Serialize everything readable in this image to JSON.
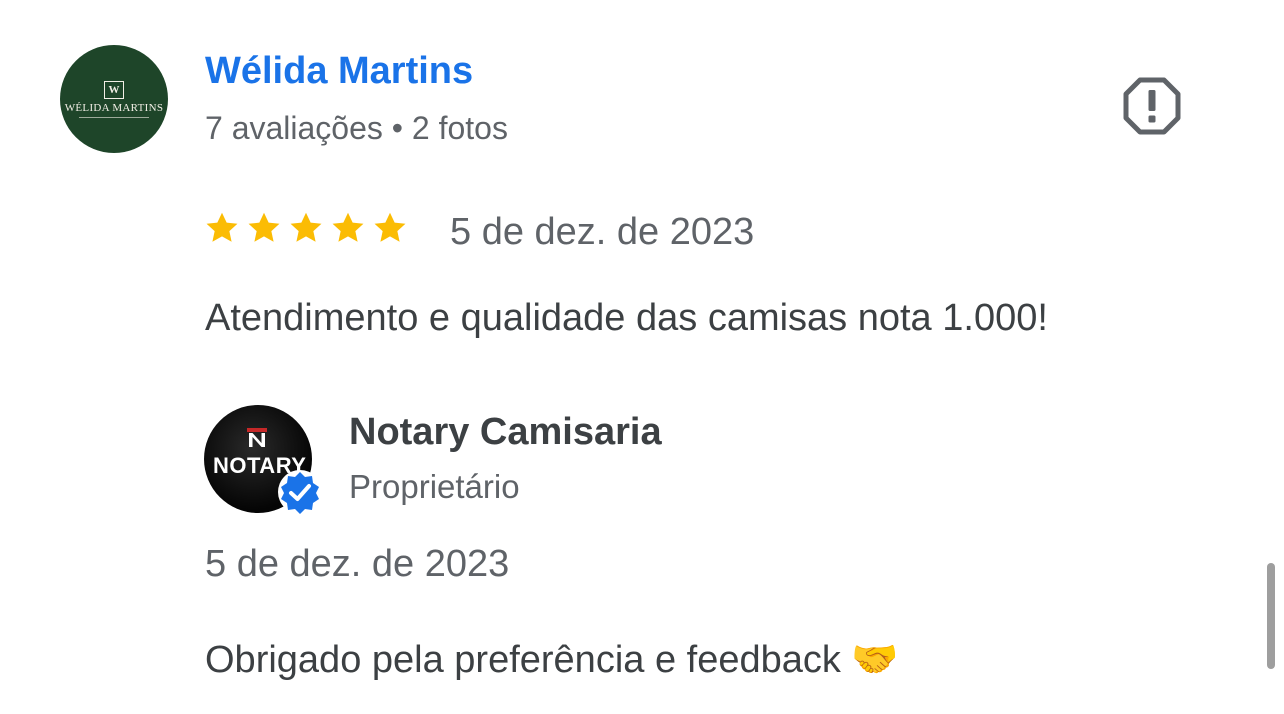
{
  "review": {
    "reviewer": {
      "name": "Wélida Martins",
      "meta": "7 avaliações • 2 fotos",
      "avatar": {
        "monogram": "W",
        "brand_text": "WÉLIDA MARTINS",
        "bg_color": "#1e4529"
      }
    },
    "rating": {
      "stars": 5,
      "max": 5,
      "color": "#fbbc04"
    },
    "date": "5 de dez. de 2023",
    "text": "Atendimento e qualidade das camisas nota 1.000!",
    "report_icon": "report-flag-icon"
  },
  "reply": {
    "owner": {
      "name": "Notary Camisaria",
      "role": "Proprietário",
      "avatar": {
        "logo_text": "NOTARY",
        "badge_icon": "verified-badge-icon",
        "badge_color": "#1a73e8"
      }
    },
    "date": "5 de dez. de 2023",
    "text": "Obrigado pela preferência e feedback 🤝"
  },
  "colors": {
    "link": "#1a73e8",
    "text_primary": "#3c4043",
    "text_secondary": "#5f6368"
  }
}
